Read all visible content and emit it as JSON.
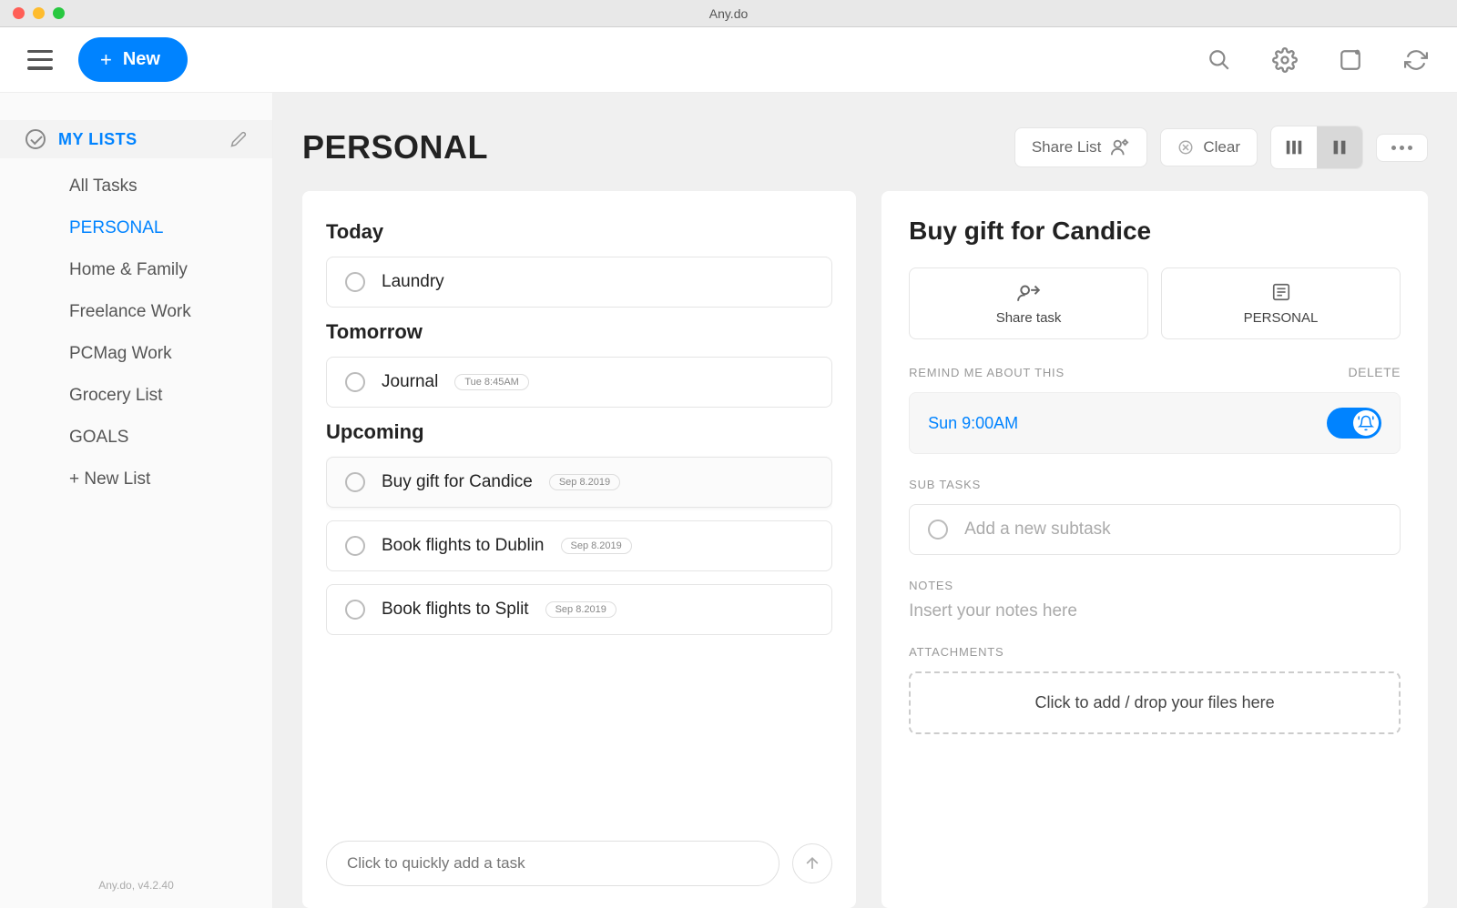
{
  "window": {
    "title": "Any.do"
  },
  "toolbar": {
    "new_label": "New"
  },
  "sidebar": {
    "header_label": "MY LISTS",
    "items": [
      {
        "label": "All Tasks",
        "active": false
      },
      {
        "label": "PERSONAL",
        "active": true
      },
      {
        "label": "Home & Family",
        "active": false
      },
      {
        "label": "Freelance Work",
        "active": false
      },
      {
        "label": "PCMag Work",
        "active": false
      },
      {
        "label": "Grocery List",
        "active": false
      },
      {
        "label": "GOALS",
        "active": false
      },
      {
        "label": "+ New List",
        "active": false
      }
    ],
    "version": "Any.do, v4.2.40"
  },
  "main": {
    "list_title": "PERSONAL",
    "share_label": "Share List",
    "clear_label": "Clear",
    "sections": [
      {
        "title": "Today",
        "tasks": [
          {
            "label": "Laundry",
            "badge": ""
          }
        ]
      },
      {
        "title": "Tomorrow",
        "tasks": [
          {
            "label": "Journal",
            "badge": "Tue 8:45AM"
          }
        ]
      },
      {
        "title": "Upcoming",
        "tasks": [
          {
            "label": "Buy gift for Candice",
            "badge": "Sep 8.2019",
            "selected": true
          },
          {
            "label": "Book flights to Dublin",
            "badge": "Sep 8.2019"
          },
          {
            "label": "Book flights to Split",
            "badge": "Sep 8.2019"
          }
        ]
      }
    ],
    "quick_add_placeholder": "Click to quickly add a task"
  },
  "detail": {
    "title": "Buy gift for Candice",
    "share_label": "Share task",
    "list_label": "PERSONAL",
    "remind_label": "REMIND ME ABOUT THIS",
    "delete_label": "DELETE",
    "reminder_time": "Sun 9:00AM",
    "subtasks_label": "SUB TASKS",
    "subtask_placeholder": "Add a new subtask",
    "notes_label": "NOTES",
    "notes_placeholder": "Insert your notes here",
    "attachments_label": "ATTACHMENTS",
    "attachments_drop": "Click to add / drop your files here"
  }
}
